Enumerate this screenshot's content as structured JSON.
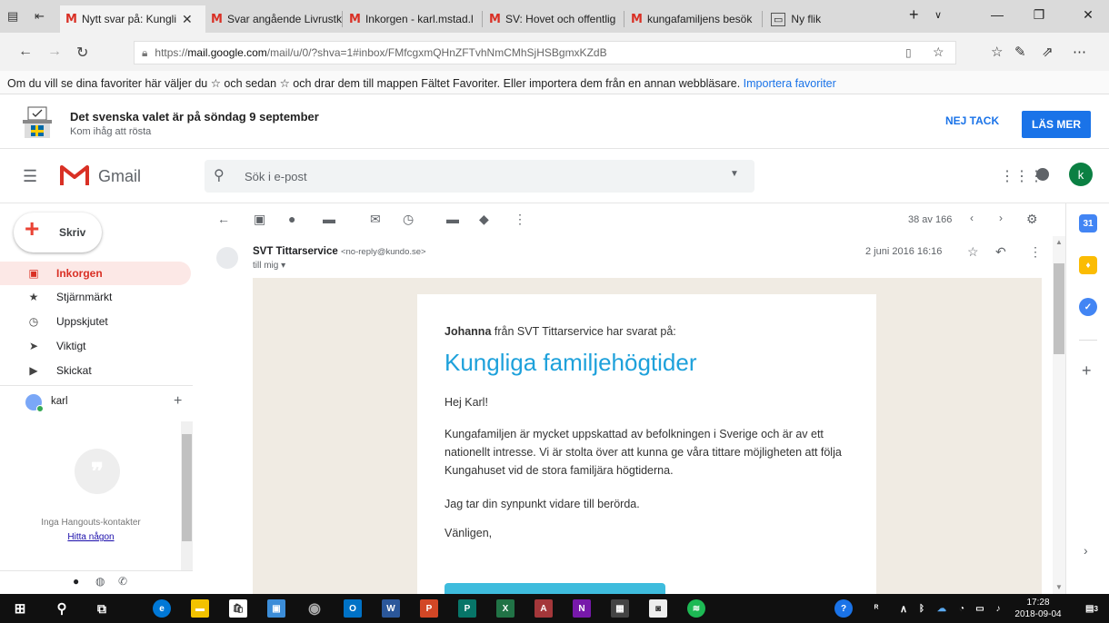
{
  "browser": {
    "tabs": [
      {
        "label": "Nytt svar på: Kungli",
        "active": true
      },
      {
        "label": "Svar angående Livrustk"
      },
      {
        "label": "Inkorgen - karl.mstad.l"
      },
      {
        "label": "SV: Hovet och offentlig"
      },
      {
        "label": "kungafamiljens besök"
      },
      {
        "label": "Ny flik"
      }
    ],
    "url_prefix": "https://",
    "url_host": "mail.google.com",
    "url_path": "/mail/u/0/?shva=1#inbox/FMfcgxmQHnZFTvhNmCMhSjHSBgmxKZdB",
    "favorites_text": "Om du vill se dina favoriter här väljer du",
    "favorites_text2": "och sedan",
    "favorites_text3": "och drar dem till mappen Fältet Favoriter. Eller importera dem från en annan webbläsare.",
    "favorites_link": "Importera favoriter"
  },
  "banner": {
    "title": "Det svenska valet är på söndag 9 september",
    "subtitle": "Kom ihåg att rösta",
    "decline": "NEJ TACK",
    "read_more": "LÄS MER"
  },
  "header": {
    "app_name": "Gmail",
    "search_placeholder": "Sök i e-post",
    "avatar_letter": "k"
  },
  "sidebar": {
    "compose": "Skriv",
    "items": [
      {
        "label": "Inkorgen",
        "icon": "inbox-icon",
        "active": true
      },
      {
        "label": "Stjärnmärkt",
        "icon": "star-icon"
      },
      {
        "label": "Uppskjutet",
        "icon": "clock-icon"
      },
      {
        "label": "Viktigt",
        "icon": "important-icon"
      },
      {
        "label": "Skickat",
        "icon": "send-icon"
      }
    ],
    "user": "karl",
    "hangouts_empty": "Inga Hangouts-kontakter",
    "hangouts_find": "Hitta någon"
  },
  "toolbar": {
    "count": "38 av 166"
  },
  "message": {
    "sender_name": "SVT Tittarservice",
    "sender_email": "<no-reply@kundo.se>",
    "to": "till mig",
    "date": "2 juni 2016 16:16"
  },
  "email": {
    "from_name": "Johanna",
    "from_rest": "från SVT Tittarservice har svarat på:",
    "title": "Kungliga familjehögtider",
    "greeting": "Hej Karl!",
    "paragraph1": "Kungafamiljen är mycket uppskattad av befolkningen i Sverige och är av ett nationellt intresse. Vi är stolta över att kunna ge våra tittare möjligheten att följa Kungahuset vid de stora familjära högtiderna.",
    "paragraph2": "Jag tar din synpunkt vidare till berörda.",
    "closing": "Vänligen,"
  },
  "taskbar": {
    "time": "17:28",
    "date": "2018-09-04",
    "notif_count": "3"
  },
  "colors": {
    "gmail_red": "#d93025",
    "link_blue": "#1a73e8",
    "email_title": "#1ea1db",
    "cta": "#3ebcdd"
  }
}
